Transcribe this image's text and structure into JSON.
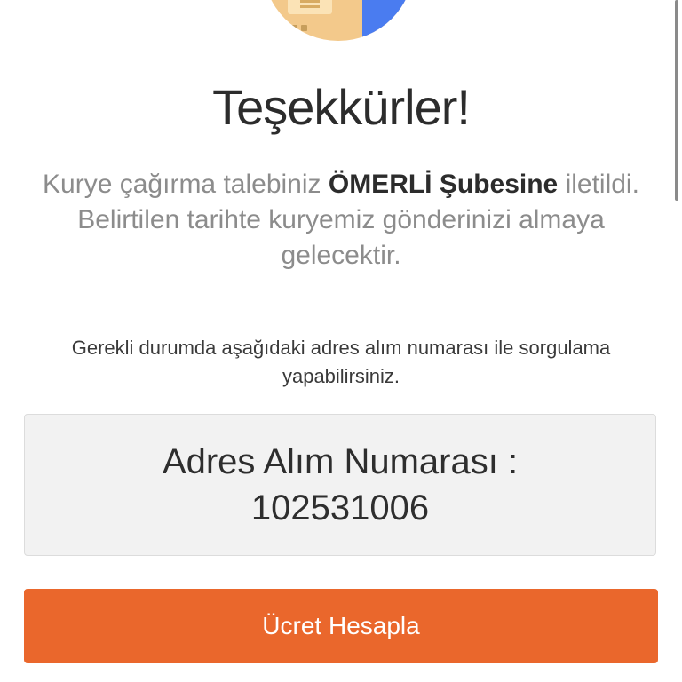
{
  "header": {
    "illustration_icon": "package-receipt-icon"
  },
  "title": "Teşekkürler!",
  "message": {
    "prefix": "Kurye çağırma talebiniz ",
    "branch": "ÖMERLİ Şubesine",
    "suffix": " iletildi. Belirtilen tarihte kuryemiz gönderinizi almaya gelecektir."
  },
  "hint": "Gerekli durumda aşağıdaki adres alım numarası ile sorgulama yapabilirsiniz.",
  "pickup": {
    "label": "Adres Alım Numarası :",
    "number": "102531006"
  },
  "button": {
    "label": "Ücret Hesapla"
  },
  "colors": {
    "accent": "#ea672c",
    "box_background": "#f2f2f2",
    "title_text": "#2c2c2c",
    "muted_text": "#8c8c8c"
  }
}
